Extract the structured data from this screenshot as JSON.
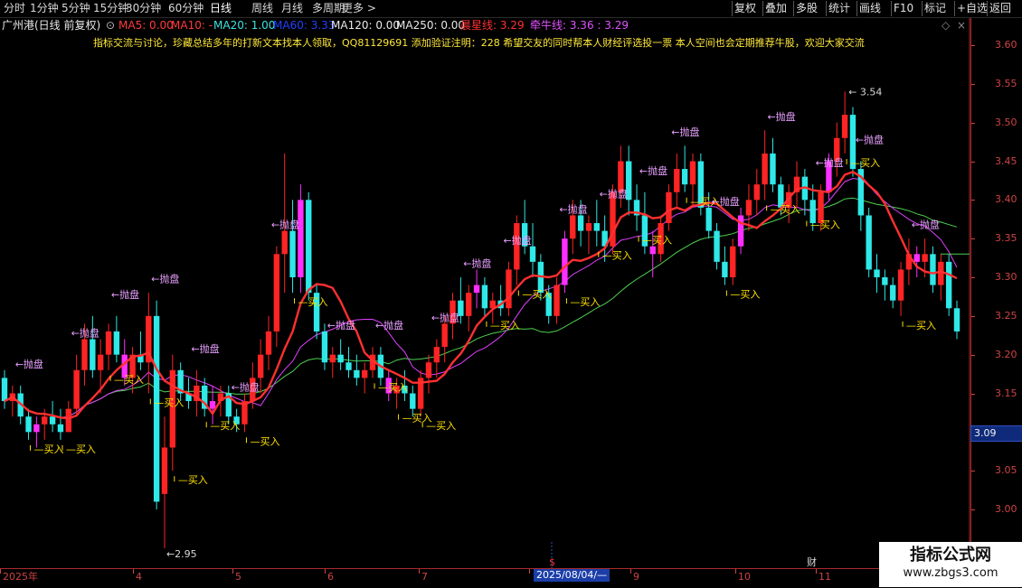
{
  "colors": {
    "up": "#ff2424",
    "down": "#2fe8e8",
    "ma_main": "#ff3030",
    "ma_purple": "#e040ff",
    "ma_green": "#4cd050",
    "buy": "#ffe000",
    "sell": "#e8a0ff",
    "axis": "#cc4444",
    "cursor": "#1b3ea8"
  },
  "period_tabs": [
    {
      "label": "分时",
      "active": false
    },
    {
      "label": "1分钟",
      "active": false
    },
    {
      "label": "5分钟",
      "active": false
    },
    {
      "label": "15分钟",
      "active": false
    },
    {
      "label": "30分钟",
      "active": false
    },
    {
      "label": "60分钟",
      "active": false
    },
    {
      "label": "日线",
      "active": true
    },
    {
      "label": "周线",
      "active": false
    },
    {
      "label": "月线",
      "active": false
    },
    {
      "label": "多周期",
      "active": false
    },
    {
      "label": "更多 >",
      "active": false
    }
  ],
  "toolbar": [
    "复权",
    "叠加",
    "多股",
    "统计",
    "画线",
    "F10",
    "标记",
    "+自选",
    "返回"
  ],
  "info": {
    "stock_title": "广州港(日线 前复权)",
    "ma5": "MA5: 0.00",
    "ma10": "MA10: -",
    "ma20": "MA20: 1.00",
    "ma60": "MA60: 3.33",
    "ma120": "MA120: 0.00",
    "ma250": "MA250: 0.00",
    "star": "晨星线: 3.29",
    "bull": "牵牛线: 3.36 : 3.29"
  },
  "banner_text": "指标交流与讨论，珍藏总结多年的打新文本找本人领取，QQ81129691 添加验证注明：228 希望交友的同时帮本人财经评选投一票    本人空间也会定期推荐牛股，欢迎大家交流",
  "price_axis": {
    "ticks": [
      "3.60",
      "3.55",
      "3.50",
      "3.45",
      "3.40",
      "3.35",
      "3.30",
      "3.25",
      "3.20",
      "3.15",
      "3.10",
      "3.05",
      "3.00"
    ],
    "current": "3.09"
  },
  "time_axis": {
    "labels": [
      "2025年",
      "4",
      "5",
      "6",
      "7",
      "8",
      "9",
      "10",
      "11"
    ],
    "cursor_date": "2025/08/04/—",
    "marker_s": "$",
    "marker_cai": "财"
  },
  "annotations": {
    "high": "3.54",
    "low": "2.95",
    "buy": "买入",
    "sell": "抛盘"
  },
  "watermark": {
    "title": "指标公式网",
    "url": "www.zbgs3.com"
  },
  "chart_data": {
    "type": "candlestick",
    "ylim": [
      2.93,
      3.63
    ],
    "candles": [
      [
        3.17,
        3.18,
        3.13,
        3.14
      ],
      [
        3.14,
        3.16,
        3.12,
        3.15
      ],
      [
        3.15,
        3.16,
        3.11,
        3.12
      ],
      [
        3.12,
        3.13,
        3.09,
        3.1
      ],
      [
        3.1,
        3.12,
        3.08,
        3.11
      ],
      [
        3.11,
        3.13,
        3.09,
        3.12
      ],
      [
        3.12,
        3.14,
        3.1,
        3.11
      ],
      [
        3.11,
        3.13,
        3.09,
        3.1
      ],
      [
        3.1,
        3.14,
        3.1,
        3.13
      ],
      [
        3.13,
        3.2,
        3.12,
        3.18
      ],
      [
        3.18,
        3.24,
        3.16,
        3.22
      ],
      [
        3.22,
        3.25,
        3.17,
        3.18
      ],
      [
        3.18,
        3.22,
        3.15,
        3.2
      ],
      [
        3.2,
        3.24,
        3.18,
        3.23
      ],
      [
        3.23,
        3.25,
        3.19,
        3.2
      ],
      [
        3.2,
        3.22,
        3.16,
        3.17
      ],
      [
        3.17,
        3.21,
        3.15,
        3.2
      ],
      [
        3.2,
        3.23,
        3.18,
        3.19
      ],
      [
        3.19,
        3.28,
        3.15,
        3.25
      ],
      [
        3.25,
        3.27,
        3.0,
        3.01
      ],
      [
        3.02,
        3.12,
        2.95,
        3.08
      ],
      [
        3.08,
        3.2,
        3.05,
        3.18
      ],
      [
        3.18,
        3.19,
        3.14,
        3.15
      ],
      [
        3.15,
        3.17,
        3.13,
        3.14
      ],
      [
        3.14,
        3.18,
        3.12,
        3.16
      ],
      [
        3.16,
        3.17,
        3.12,
        3.13
      ],
      [
        3.13,
        3.16,
        3.11,
        3.14
      ],
      [
        3.14,
        3.16,
        3.12,
        3.15
      ],
      [
        3.15,
        3.16,
        3.11,
        3.12
      ],
      [
        3.12,
        3.13,
        3.1,
        3.11
      ],
      [
        3.11,
        3.15,
        3.1,
        3.14
      ],
      [
        3.14,
        3.19,
        3.13,
        3.17
      ],
      [
        3.17,
        3.22,
        3.15,
        3.2
      ],
      [
        3.2,
        3.25,
        3.18,
        3.23
      ],
      [
        3.23,
        3.34,
        3.21,
        3.33
      ],
      [
        3.33,
        3.46,
        3.28,
        3.36
      ],
      [
        3.36,
        3.4,
        3.28,
        3.3
      ],
      [
        3.3,
        3.42,
        3.28,
        3.4
      ],
      [
        3.4,
        3.41,
        3.27,
        3.28
      ],
      [
        3.28,
        3.29,
        3.22,
        3.23
      ],
      [
        3.23,
        3.24,
        3.18,
        3.19
      ],
      [
        3.19,
        3.21,
        3.17,
        3.2
      ],
      [
        3.2,
        3.22,
        3.18,
        3.19
      ],
      [
        3.19,
        3.21,
        3.17,
        3.18
      ],
      [
        3.18,
        3.2,
        3.16,
        3.17
      ],
      [
        3.17,
        3.19,
        3.15,
        3.18
      ],
      [
        3.18,
        3.21,
        3.17,
        3.2
      ],
      [
        3.2,
        3.21,
        3.16,
        3.17
      ],
      [
        3.17,
        3.18,
        3.14,
        3.15
      ],
      [
        3.15,
        3.17,
        3.13,
        3.16
      ],
      [
        3.16,
        3.18,
        3.14,
        3.15
      ],
      [
        3.15,
        3.16,
        3.12,
        3.13
      ],
      [
        3.13,
        3.18,
        3.12,
        3.17
      ],
      [
        3.17,
        3.2,
        3.15,
        3.19
      ],
      [
        3.19,
        3.22,
        3.17,
        3.21
      ],
      [
        3.21,
        3.25,
        3.19,
        3.24
      ],
      [
        3.24,
        3.28,
        3.22,
        3.27
      ],
      [
        3.27,
        3.3,
        3.24,
        3.25
      ],
      [
        3.25,
        3.29,
        3.23,
        3.28
      ],
      [
        3.28,
        3.31,
        3.26,
        3.29
      ],
      [
        3.29,
        3.3,
        3.25,
        3.26
      ],
      [
        3.26,
        3.28,
        3.24,
        3.27
      ],
      [
        3.27,
        3.29,
        3.25,
        3.26
      ],
      [
        3.26,
        3.32,
        3.25,
        3.31
      ],
      [
        3.31,
        3.38,
        3.29,
        3.37
      ],
      [
        3.37,
        3.4,
        3.33,
        3.34
      ],
      [
        3.34,
        3.37,
        3.3,
        3.32
      ],
      [
        3.32,
        3.33,
        3.27,
        3.28
      ],
      [
        3.28,
        3.29,
        3.24,
        3.25
      ],
      [
        3.25,
        3.3,
        3.24,
        3.29
      ],
      [
        3.29,
        3.36,
        3.28,
        3.35
      ],
      [
        3.35,
        3.4,
        3.33,
        3.38
      ],
      [
        3.38,
        3.4,
        3.34,
        3.36
      ],
      [
        3.36,
        3.38,
        3.33,
        3.37
      ],
      [
        3.37,
        3.4,
        3.34,
        3.36
      ],
      [
        3.36,
        3.38,
        3.32,
        3.34
      ],
      [
        3.34,
        3.42,
        3.33,
        3.41
      ],
      [
        3.41,
        3.47,
        3.39,
        3.45
      ],
      [
        3.45,
        3.47,
        3.38,
        3.4
      ],
      [
        3.4,
        3.42,
        3.36,
        3.38
      ],
      [
        3.38,
        3.41,
        3.33,
        3.34
      ],
      [
        3.34,
        3.36,
        3.3,
        3.33
      ],
      [
        3.33,
        3.38,
        3.32,
        3.37
      ],
      [
        3.37,
        3.42,
        3.36,
        3.41
      ],
      [
        3.41,
        3.46,
        3.39,
        3.44
      ],
      [
        3.44,
        3.47,
        3.41,
        3.42
      ],
      [
        3.42,
        3.46,
        3.39,
        3.45
      ],
      [
        3.45,
        3.46,
        3.38,
        3.39
      ],
      [
        3.39,
        3.41,
        3.35,
        3.36
      ],
      [
        3.36,
        3.37,
        3.31,
        3.32
      ],
      [
        3.32,
        3.34,
        3.29,
        3.3
      ],
      [
        3.3,
        3.35,
        3.29,
        3.34
      ],
      [
        3.34,
        3.39,
        3.33,
        3.38
      ],
      [
        3.38,
        3.42,
        3.36,
        3.4
      ],
      [
        3.4,
        3.44,
        3.38,
        3.42
      ],
      [
        3.42,
        3.49,
        3.4,
        3.46
      ],
      [
        3.46,
        3.48,
        3.41,
        3.42
      ],
      [
        3.42,
        3.43,
        3.38,
        3.39
      ],
      [
        3.39,
        3.42,
        3.37,
        3.41
      ],
      [
        3.41,
        3.45,
        3.39,
        3.43
      ],
      [
        3.43,
        3.44,
        3.38,
        3.4
      ],
      [
        3.4,
        3.42,
        3.36,
        3.37
      ],
      [
        3.37,
        3.42,
        3.36,
        3.41
      ],
      [
        3.41,
        3.46,
        3.4,
        3.45
      ],
      [
        3.45,
        3.5,
        3.43,
        3.48
      ],
      [
        3.48,
        3.54,
        3.46,
        3.51
      ],
      [
        3.51,
        3.52,
        3.43,
        3.44
      ],
      [
        3.44,
        3.45,
        3.36,
        3.38
      ],
      [
        3.38,
        3.39,
        3.3,
        3.31
      ],
      [
        3.31,
        3.33,
        3.28,
        3.3
      ],
      [
        3.3,
        3.31,
        3.27,
        3.29
      ],
      [
        3.29,
        3.3,
        3.26,
        3.27
      ],
      [
        3.27,
        3.32,
        3.25,
        3.31
      ],
      [
        3.31,
        3.35,
        3.29,
        3.33
      ],
      [
        3.33,
        3.34,
        3.3,
        3.32
      ],
      [
        3.32,
        3.35,
        3.3,
        3.33
      ],
      [
        3.33,
        3.34,
        3.28,
        3.29
      ],
      [
        3.29,
        3.33,
        3.27,
        3.32
      ],
      [
        3.32,
        3.33,
        3.25,
        3.26
      ],
      [
        3.26,
        3.27,
        3.22,
        3.23
      ]
    ],
    "buy_signals": [
      3,
      7,
      13,
      18,
      21,
      25,
      30,
      36,
      46,
      49,
      52,
      60,
      64,
      70,
      74,
      79,
      85,
      90,
      95,
      100,
      105,
      112
    ],
    "sell_signals": [
      2,
      9,
      14,
      19,
      24,
      29,
      34,
      41,
      47,
      54,
      58,
      63,
      70,
      75,
      80,
      84,
      89,
      96,
      102,
      107,
      114
    ]
  }
}
